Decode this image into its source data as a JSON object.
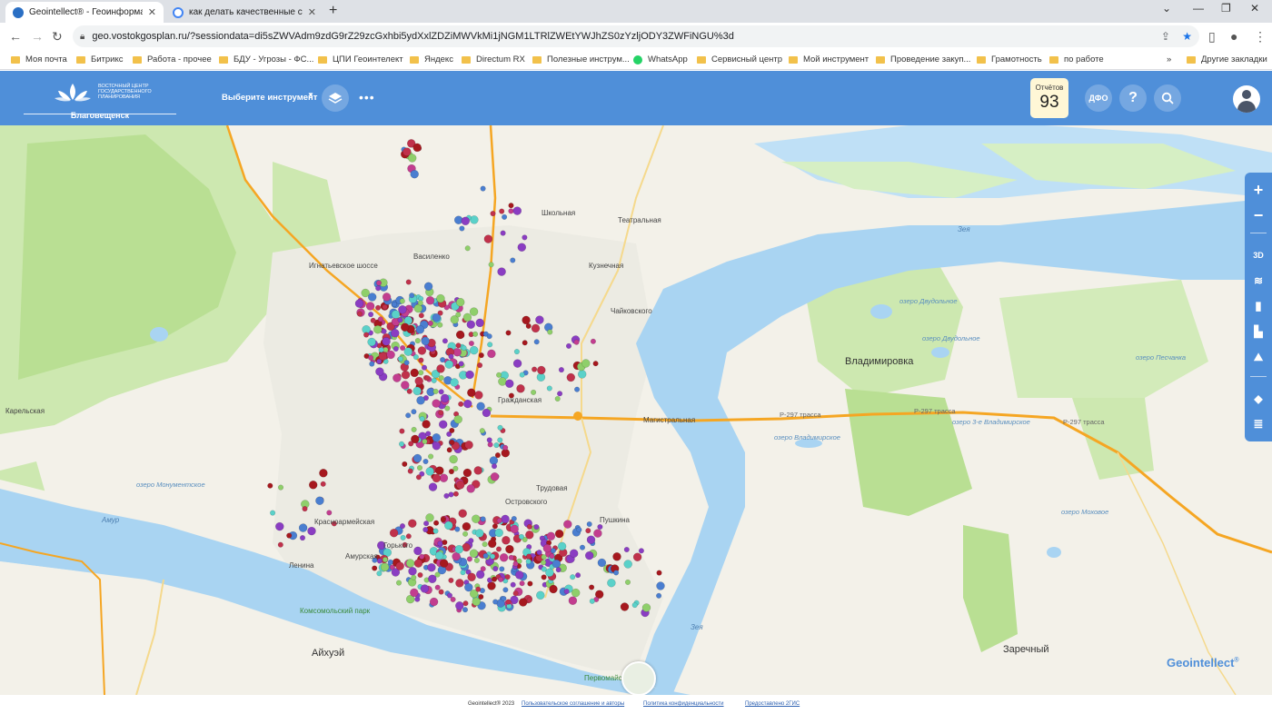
{
  "browser": {
    "tabs": [
      {
        "title": "Geointellect® - Геоинформаци",
        "active": true
      },
      {
        "title": "как делать качественные сним",
        "active": false
      }
    ],
    "new_tab_symbol": "+",
    "window_controls": [
      "⌄",
      "—",
      "❐",
      "✕"
    ],
    "url": "geo.vostokgosplan.ru/?sessiondata=di5sZWVAdm9zdG9rZ29zcGxhbi5ydXxlZDZiMWVkMi1jNGM1LTRlZWEtYWJhZS0zYzljODY3ZWFiNGU%3d",
    "bookmarks": [
      "Моя почта",
      "Битрикс",
      "Работа - прочее",
      "БДУ - Угрозы - ФС...",
      "ЦПИ Геоинтелект",
      "Яндекс",
      "Directum RX",
      "Полезные инструм...",
      "WhatsApp",
      "Сервисный центр",
      "Мой инструмент",
      "Проведение закуп...",
      "Грамотность",
      "по работе"
    ],
    "bookmarks_more": "»",
    "other_bookmarks": "Другие закладки"
  },
  "header": {
    "logo_text": "ВОСТОЧНЫЙ ЦЕНТР ГОСУДАРСТВЕННОГО ПЛАНИРОВАНИЯ",
    "city": "Благовещенск",
    "tool_select": "Выберите инструмент",
    "reports_label": "Отчётов",
    "reports_count": "93",
    "dfo_label": "ДФО",
    "help_label": "?"
  },
  "map": {
    "town_labels": {
      "vladimirovka": "Владимировка",
      "aihui": "Айхуэй",
      "zarechny": "Заречный"
    },
    "lake_labels": {
      "dvudolnoe1": "озеро Двудольное",
      "dvudolnoe2": "озеро Двудольное",
      "pesyanka": "озеро Песчанка",
      "vladimir3": "озеро 3-е Владимирское",
      "vladimir": "озеро Владимирское",
      "monument": "озеро Монументское",
      "mokhovoe": "озеро Моховое"
    },
    "road_labels": {
      "r297a": "Р-297 трасса",
      "r297b": "Р-297 трасса",
      "r297c": "Р-297 трасса",
      "magistral": "Магистральная"
    },
    "river_labels": {
      "zeya": "Зея",
      "amur": "Амур",
      "zeya2": "Зея"
    },
    "street_labels": {
      "shkolnaya": "Школьная",
      "vasilenko": "Василенко",
      "ignatievskoe": "Игнатьевское шоссе",
      "kuznechnaya": "Кузнечная",
      "teatralnaya": "Театральная",
      "chaykovskogo": "Чайковского",
      "grazhdanskaya": "Гражданская",
      "trudovaya": "Трудовая",
      "ostrovskogo": "Островского",
      "krasnoarmeyskaya": "Красноармейская",
      "amurskaya": "Амурская",
      "gorkogo": "Горького",
      "pushkina": "Пушкина",
      "lenina": "Ленина",
      "karelskaya": "Карельская",
      "komsomolsky": "Комсомольский парк",
      "pervomaisky": "Первомайский"
    },
    "point_colors": [
      "#c0314b",
      "#4a7ed0",
      "#8fcf6a",
      "#c23d8f",
      "#5ad1c9",
      "#8a3dc2",
      "#a6181e"
    ],
    "zoom_in": "+",
    "zoom_out": "−",
    "mode_3d": "3D"
  },
  "brand": "Geointellect",
  "footer": {
    "copyright": "Geointellect® 2023",
    "terms": "Пользовательское соглашение и авторы",
    "privacy": "Политика конфиденциальности",
    "provided": "Предоставлено 2ГИС"
  }
}
